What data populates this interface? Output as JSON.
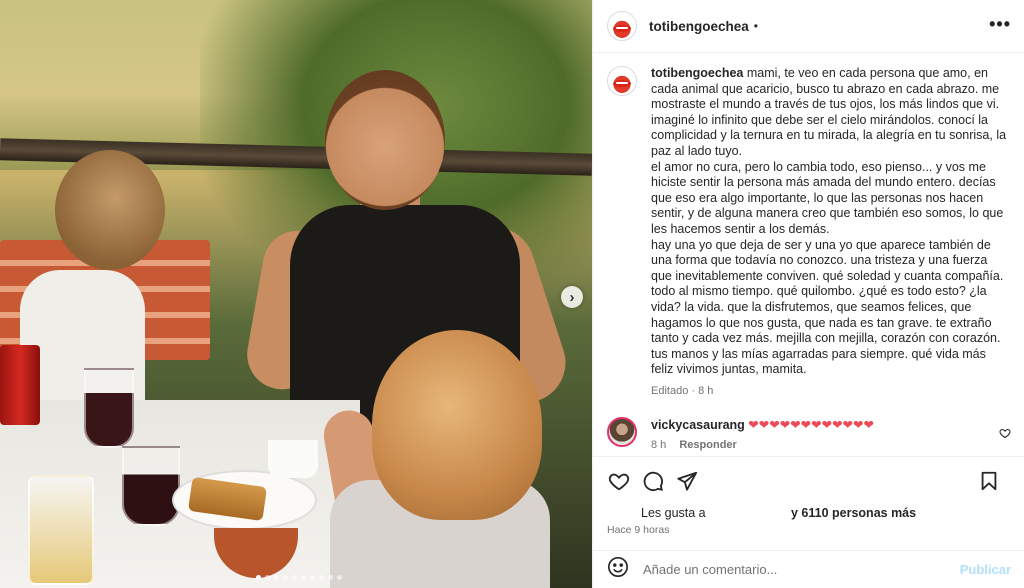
{
  "post": {
    "username": "totibengoechea",
    "separator": "•",
    "more_icon": "more-horizontal-icon",
    "image": {
      "alt": "",
      "carousel_total": 10,
      "carousel_active": 0
    }
  },
  "caption": {
    "username": "totibengoechea",
    "text": "mami, te veo en cada persona que amo, en cada animal que acaricio, busco tu abrazo en cada abrazo. me mostraste el mundo a través de tus ojos, los más lindos que vi. imaginé lo infinito que debe ser el cielo mirándolos. conocí la complicidad y la ternura en tu mirada, la alegría en tu sonrisa, la paz al lado tuyo.\nel amor no cura, pero lo cambia todo, eso pienso... y vos me hiciste sentir la persona más amada del mundo entero. decías que eso era algo importante, lo que las personas nos hacen sentir, y de alguna manera creo que también eso somos, lo que les hacemos sentir a los demás.\nhay una yo que deja de ser y una yo que aparece también de una forma que todavía no conozco. una tristeza y una fuerza que inevitablemente conviven. qué soledad y cuanta compañía. todo al mismo tiempo. qué quilombo. ¿qué es todo esto? ¿la vida? la vida. que la disfrutemos, que seamos felices, que hagamos lo que nos gusta, que nada es tan grave. te extraño tanto y cada vez más. mejilla con mejilla, corazón con corazón. tus manos y las mías agarradas para siempre. qué vida más feliz vivimos juntas, mamita.",
    "edited": "Editado · 8 h"
  },
  "comment": {
    "username": "vickycasaurang",
    "text": "❤️❤️❤️❤️❤️❤️❤️❤️❤️❤️❤️❤️",
    "hearts": "❤❤❤❤❤❤❤❤❤❤❤❤",
    "time": "8 h",
    "reply": "Responder",
    "like_icon": "heart-outline-small-icon"
  },
  "actions": {
    "like_icon": "heart-outline-icon",
    "comment_icon": "comment-bubble-icon",
    "share_icon": "paper-plane-icon",
    "save_icon": "bookmark-icon"
  },
  "likes": {
    "prefix": "Les gusta a",
    "count_text": "y 6110 personas más"
  },
  "timestamp": "Hace 9 horas",
  "comment_box": {
    "emoji_icon": "smiley-icon",
    "placeholder": "Añade un comentario...",
    "value": "",
    "post_label": "Publicar"
  },
  "colors": {
    "hearts": "#ed4956",
    "post_button_disabled": "#b2dffc",
    "secondary_text": "#737373"
  }
}
